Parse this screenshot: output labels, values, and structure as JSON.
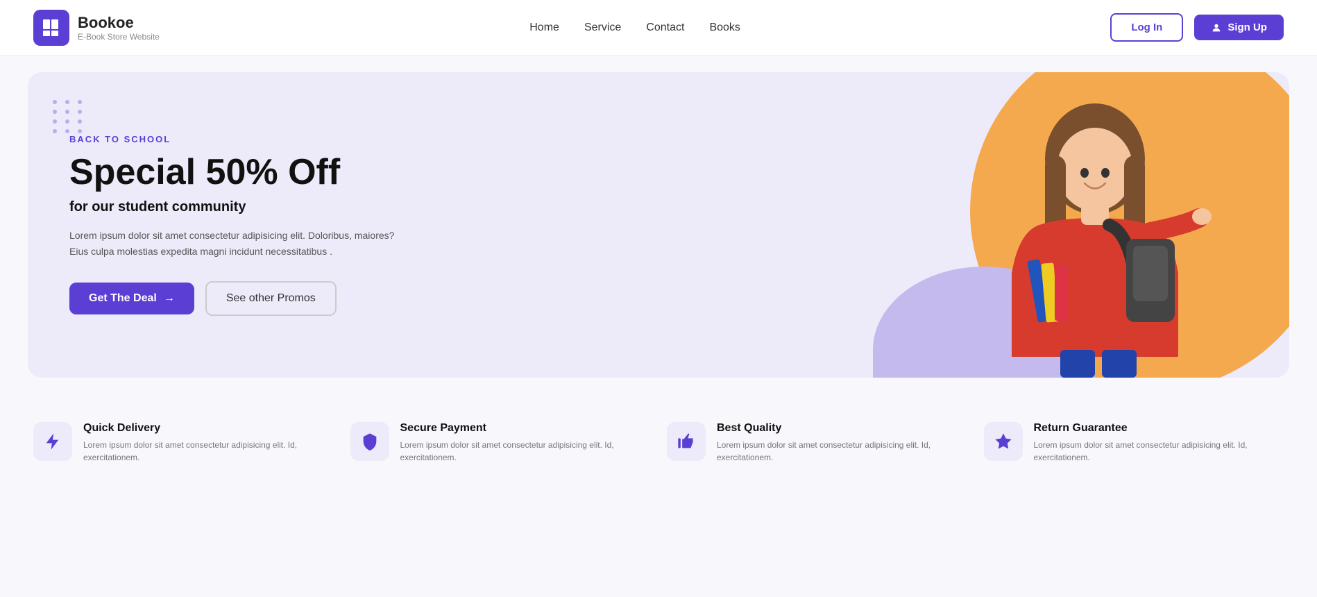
{
  "brand": {
    "name": "Bookoe",
    "tagline": "E-Book Store Website"
  },
  "nav": {
    "links": [
      "Home",
      "Service",
      "Contact",
      "Books"
    ],
    "login_label": "Log In",
    "signup_label": "Sign Up"
  },
  "hero": {
    "tag": "BACK TO SCHOOL",
    "title": "Special 50% Off",
    "subtitle": "for our student community",
    "description": "Lorem ipsum dolor sit amet consectetur adipisicing elit. Doloribus, maiores? Eius culpa molestias expedita magni incidunt necessitatibus .",
    "btn_deal": "Get The Deal",
    "btn_promos": "See other Promos"
  },
  "features": [
    {
      "icon": "lightning",
      "title": "Quick Delivery",
      "description": "Lorem ipsum dolor sit amet consectetur adipisicing elit. Id, exercitationem."
    },
    {
      "icon": "shield",
      "title": "Secure Payment",
      "description": "Lorem ipsum dolor sit amet consectetur adipisicing elit. Id, exercitationem."
    },
    {
      "icon": "thumbsup",
      "title": "Best Quality",
      "description": "Lorem ipsum dolor sit amet consectetur adipisicing elit. Id, exercitationem."
    },
    {
      "icon": "star",
      "title": "Return Guarantee",
      "description": "Lorem ipsum dolor sit amet consectetur adipisicing elit. Id, exercitationem."
    }
  ]
}
